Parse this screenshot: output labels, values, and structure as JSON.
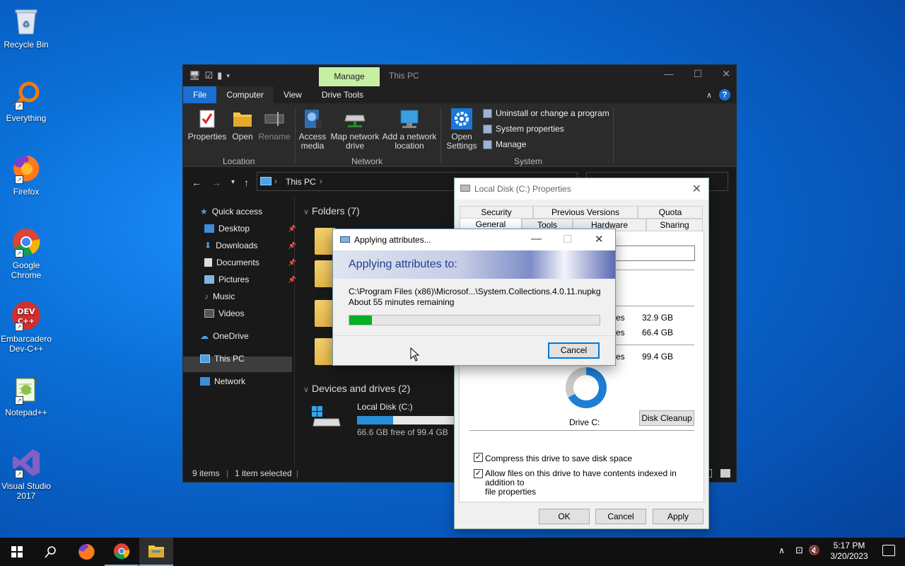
{
  "desktop": {
    "icons": [
      {
        "label": "Recycle Bin"
      },
      {
        "label": "Everything"
      },
      {
        "label": "Firefox"
      },
      {
        "label": "Google Chrome"
      },
      {
        "label": "Embarcadero Dev-C++"
      },
      {
        "label": "Notepad++"
      },
      {
        "label": "Visual Studio 2017"
      }
    ]
  },
  "explorer": {
    "manage_tab": "Manage",
    "title": "This PC",
    "tabs": [
      "File",
      "Computer",
      "View",
      "Drive Tools"
    ],
    "ribbon": {
      "properties": "Properties",
      "open": "Open",
      "rename": "Rename",
      "access_media": "Access media",
      "map_network_drive": "Map network drive",
      "add_network_location": "Add a network location",
      "open_settings": "Open Settings",
      "uninstall": "Uninstall or change a program",
      "system_properties": "System properties",
      "manage": "Manage",
      "group_location": "Location",
      "group_network": "Network",
      "group_system": "System"
    },
    "address": "This PC",
    "nav": {
      "quick_access": "Quick access",
      "desktop": "Desktop",
      "downloads": "Downloads",
      "documents": "Documents",
      "pictures": "Pictures",
      "music": "Music",
      "videos": "Videos",
      "onedrive": "OneDrive",
      "this_pc": "This PC",
      "network": "Network"
    },
    "folders_header": "Folders (7)",
    "devices_header": "Devices and drives (2)",
    "drive": {
      "name": "Local Disk (C:)",
      "free": "66.6 GB free of 99.4 GB",
      "used_fraction": 0.33
    },
    "status": {
      "items": "9 items",
      "selected": "1 item selected"
    }
  },
  "properties": {
    "title": "Local Disk (C:) Properties",
    "tabs_row1": [
      "Security",
      "Previous Versions",
      "Quota"
    ],
    "tabs_row2": [
      "General",
      "Tools",
      "Hardware",
      "Sharing"
    ],
    "used_label_tail": "es",
    "used_value": "32.9 GB",
    "free_label_tail": "es",
    "free_value": "66.4 GB",
    "capacity_label_tail": "es",
    "capacity_value": "99.4 GB",
    "drive_label": "Drive C:",
    "disk_cleanup": "Disk Cleanup",
    "compress": "Compress this drive to save disk space",
    "index_line1": "Allow files on this drive to have contents indexed in addition to",
    "index_line2": "file properties",
    "ok": "OK",
    "cancel": "Cancel",
    "apply": "Apply"
  },
  "apply_dialog": {
    "title": "Applying attributes...",
    "heading": "Applying attributes to:",
    "path": "C:\\Program Files (x86)\\Microsof...\\System.Collections.4.0.11.nupkg",
    "remaining": "About 55 minutes remaining",
    "progress_fraction": 0.09,
    "cancel": "Cancel"
  },
  "taskbar": {
    "time": "5:17 PM",
    "date": "3/20/2023"
  }
}
